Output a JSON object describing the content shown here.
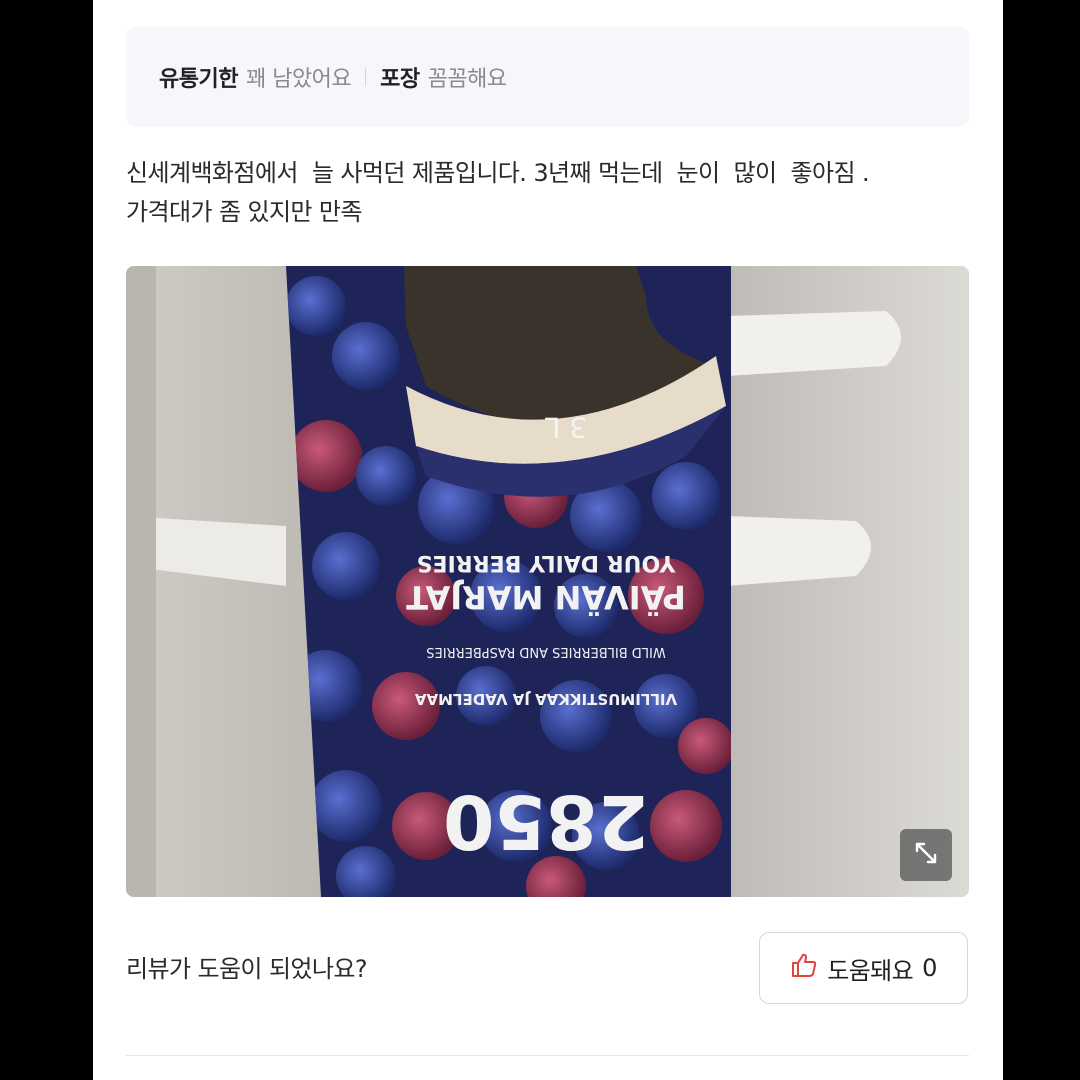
{
  "attributes": [
    {
      "key": "유통기한",
      "value": "꽤 남았어요"
    },
    {
      "key": "포장",
      "value": "꼼꼼해요"
    }
  ],
  "review": {
    "text": "신세계백화점에서  늘 사먹던 제품입니다. 3년째 먹는데  눈이  많이  좋아짐 .\n가격대가 좀 있지만 만족"
  },
  "photo": {
    "package_texts": {
      "volume": "3 L",
      "tagline": "YOUR DAILY BERRIES",
      "brand": "PÄIVÄN MARJAT",
      "desc_en": "WILD BILBERRIES AND RASPBERRIES",
      "desc_fi": "VILLIMUSTIKKAA JA VADELMAA",
      "price": "2850"
    },
    "expand_icon": "expand-arrows-icon"
  },
  "helpful": {
    "question": "리뷰가 도움이 되었나요?",
    "button_label": "도움돼요",
    "count": "0",
    "icon": "thumbs-up-icon",
    "icon_color": "#e8423f"
  }
}
